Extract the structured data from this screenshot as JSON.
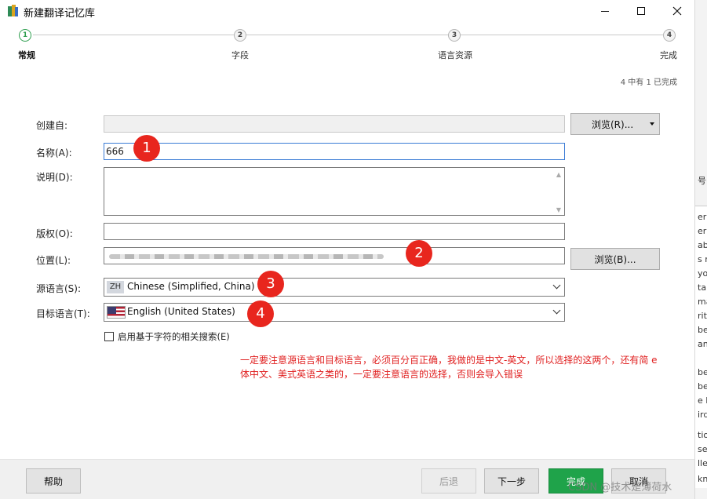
{
  "window": {
    "title": "新建翻译记忆库",
    "min_label": "",
    "max_label": "",
    "close_label": ""
  },
  "steps": [
    {
      "number": "1",
      "label": "常规"
    },
    {
      "number": "2",
      "label": "字段"
    },
    {
      "number": "3",
      "label": "语言资源"
    },
    {
      "number": "4",
      "label": "完成"
    }
  ],
  "progress": "4 中有 1 已完成",
  "form": {
    "created_from_label": "创建自:",
    "created_from_value": "",
    "browse_r_label": "浏览(R)...",
    "name_label": "名称(A):",
    "name_value": "666",
    "description_label": "说明(D):",
    "description_value": "",
    "copyright_label": "版权(O):",
    "copyright_value": "",
    "location_label": "位置(L):",
    "browse_b_label": "浏览(B)...",
    "source_lang_label": "源语言(S):",
    "source_lang_badge": "ZH",
    "source_lang_value": "Chinese (Simplified, China)",
    "target_lang_label": "目标语言(T):",
    "target_lang_value": "English (United States)",
    "char_search_label": "启用基于字符的相关搜索(E)"
  },
  "annotation": {
    "line1": "一定要注意源语言和目标语言，必须百分百正确，我做的是中文-英文，所以选择的这两个，还有简 e",
    "line2": "体中文、美式英语之类的，一定要注意语言的选择，否则会导入错误"
  },
  "markers": [
    "1",
    "2",
    "3",
    "4"
  ],
  "footer": {
    "help": "帮助",
    "back": "后退",
    "next": "下一步",
    "finish": "完成",
    "cancel": "取消"
  },
  "watermark": "CSDN @技术是薄荷水",
  "background_app": {
    "text_fragments": [
      "号(U",
      "er lo",
      "er In",
      "abili",
      "s m",
      "you",
      "tak",
      "ma",
      "rity",
      "be",
      "and",
      "be",
      "be",
      "e N",
      "ird",
      "tion",
      "se",
      "lle",
      "kno"
    ]
  },
  "colors": {
    "accent": "#2f9e4f",
    "primary_button": "#1fa34a",
    "annotation_red": "#e02020",
    "marker_red": "#e8261e"
  }
}
